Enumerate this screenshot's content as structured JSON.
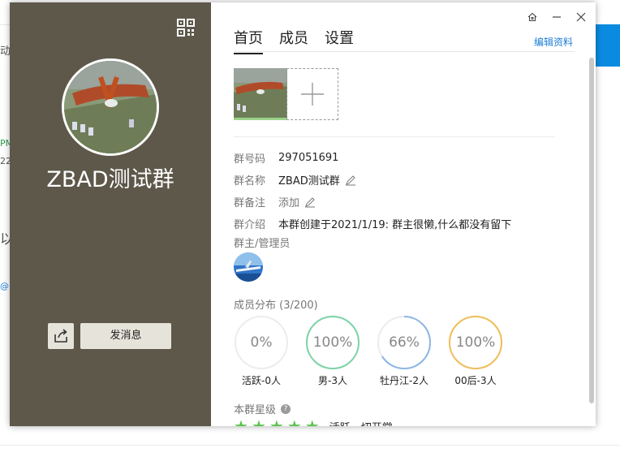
{
  "background": {
    "fragments": [
      "动",
      "PM",
      "22",
      "以",
      "@"
    ]
  },
  "dialog": {
    "left": {
      "group_name": "ZBAD测试群",
      "send_button": "发消息",
      "qr_icon": "qr-code-icon",
      "share_icon": "share-icon"
    },
    "window_controls": [
      "home-icon",
      "minimize-icon",
      "close-icon"
    ],
    "tabs": [
      "首页",
      "成员",
      "设置"
    ],
    "active_tab": "首页",
    "edit_link": "编辑资料",
    "info": [
      {
        "label": "群号码",
        "value": "297051691"
      },
      {
        "label": "群名称",
        "value": "ZBAD测试群"
      },
      {
        "label": "群备注",
        "value": "添加"
      },
      {
        "label": "群介绍",
        "value": "本群创建于2021/1/19:  群主很懒,什么都没有留下"
      }
    ],
    "admin_title": "群主/管理员",
    "distribution": {
      "title": "成员分布  (3/200)",
      "items": [
        {
          "value": "0%",
          "percent": 0,
          "label": "活跃-0人",
          "color": "#e6e6e6"
        },
        {
          "value": "100%",
          "percent": 100,
          "label": "男-3人",
          "color": "#7dd3a8"
        },
        {
          "value": "66%",
          "percent": 66,
          "label": "牡丹江-2人",
          "color": "#8cb6e6"
        },
        {
          "value": "100%",
          "percent": 100,
          "label": "00后-3人",
          "color": "#f0bf5a"
        }
      ]
    },
    "star_level": {
      "title": "本群星级",
      "stars": 5,
      "text": "活跃，切开掌"
    }
  }
}
